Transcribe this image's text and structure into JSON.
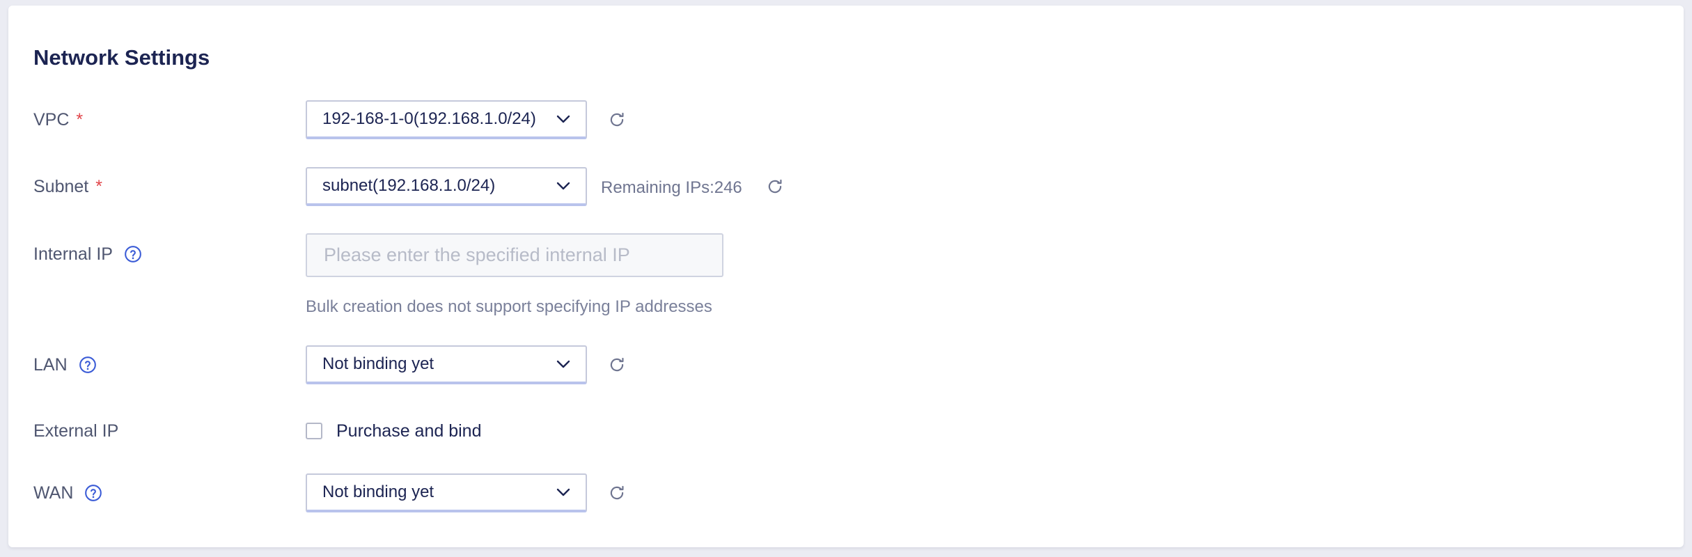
{
  "section": {
    "title": "Network Settings"
  },
  "vpc": {
    "label": "VPC",
    "required_mark": "*",
    "selected": "192-168-1-0(192.168.1.0/24)"
  },
  "subnet": {
    "label": "Subnet",
    "required_mark": "*",
    "selected": "subnet(192.168.1.0/24)",
    "remaining_ips": "Remaining IPs:246"
  },
  "internal_ip": {
    "label": "Internal IP",
    "value": "",
    "placeholder": "Please enter the specified internal IP",
    "hint": "Bulk creation does not support specifying IP addresses"
  },
  "lan": {
    "label": "LAN",
    "selected": "Not binding yet"
  },
  "external_ip": {
    "label": "External IP",
    "checkbox_label": "Purchase and bind",
    "checked": false
  },
  "wan": {
    "label": "WAN",
    "selected": "Not binding yet"
  },
  "icons": {
    "help": "question-circle-icon",
    "refresh": "refresh-icon",
    "dropdown": "chevron-down-icon"
  },
  "colors": {
    "title": "#1c2452",
    "required": "#e1454a",
    "help_icon": "#3a5bd6",
    "page_background": "#ebecf3"
  }
}
